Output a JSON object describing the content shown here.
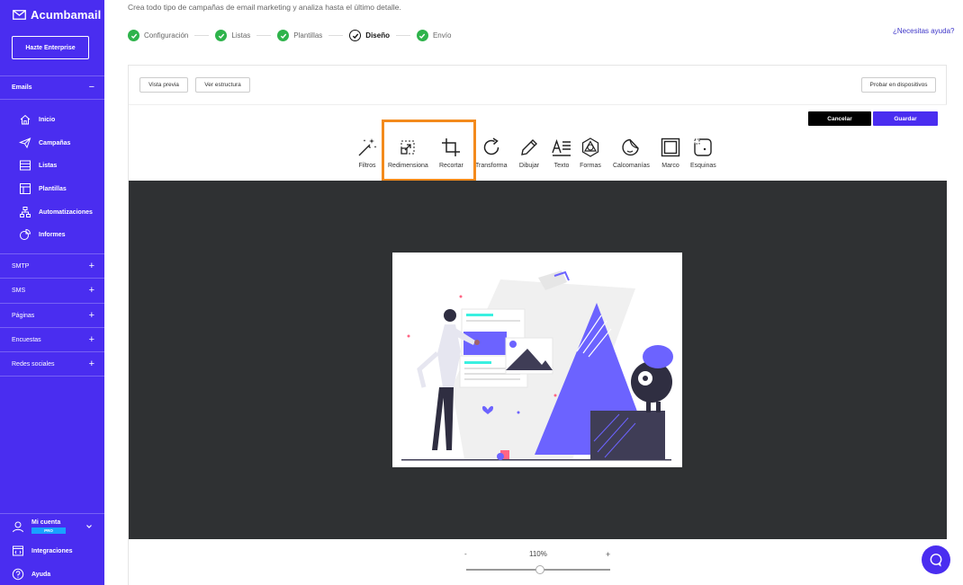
{
  "app": {
    "brand": "Acumbamail",
    "enterprise_button": "Hazte Enterprise"
  },
  "sidebar": {
    "emails_section": "Emails",
    "items": [
      {
        "label": "Inicio",
        "icon": "home-icon"
      },
      {
        "label": "Campañas",
        "icon": "paper-plane-icon"
      },
      {
        "label": "Listas",
        "icon": "list-icon"
      },
      {
        "label": "Plantillas",
        "icon": "template-icon"
      },
      {
        "label": "Automatizaciones",
        "icon": "automation-icon"
      },
      {
        "label": "Informes",
        "icon": "reports-icon"
      }
    ],
    "sections": [
      "SMTP",
      "SMS",
      "Páginas",
      "Encuestas",
      "Redes sociales"
    ],
    "account": {
      "label": "Mi cuenta",
      "badge": "PRO"
    },
    "integrations": "Integraciones",
    "help": "Ayuda"
  },
  "header": {
    "subtitle": "Crea todo tipo de campañas de email marketing y analiza hasta el último detalle.",
    "steps": [
      {
        "label": "Configuración",
        "state": "done"
      },
      {
        "label": "Listas",
        "state": "done"
      },
      {
        "label": "Plantillas",
        "state": "done"
      },
      {
        "label": "Diseño",
        "state": "current"
      },
      {
        "label": "Envío",
        "state": "done"
      }
    ],
    "help_link": "¿Necesitas ayuda?"
  },
  "panel": {
    "preview_button": "Vista previa",
    "structure_button": "Ver estructura",
    "devices_button": "Probar en dispositivos"
  },
  "editor": {
    "cancel_button": "Cancelar",
    "save_button": "Guardar",
    "tools": [
      {
        "label": "Filtros",
        "icon": "magic-wand-icon"
      },
      {
        "label": "Redimensiona",
        "icon": "resize-icon"
      },
      {
        "label": "Recortar",
        "icon": "crop-icon"
      },
      {
        "label": "Transforma",
        "icon": "rotate-icon"
      },
      {
        "label": "Dibujar",
        "icon": "pencil-icon"
      },
      {
        "label": "Texto",
        "icon": "text-icon"
      },
      {
        "label": "Formas",
        "icon": "shapes-icon"
      },
      {
        "label": "Calcomanías",
        "icon": "sticker-icon"
      },
      {
        "label": "Marco",
        "icon": "frame-icon"
      },
      {
        "label": "Esquinas",
        "icon": "corners-icon"
      }
    ],
    "zoom": {
      "minus": "-",
      "value": "110%",
      "plus": "+",
      "level": 0.51
    }
  },
  "colors": {
    "brand": "#4a2df0",
    "success": "#2eb34b",
    "highlight": "#f38a1c",
    "canvas": "#2f3133"
  }
}
